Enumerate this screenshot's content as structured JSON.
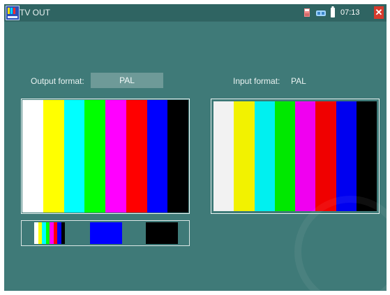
{
  "window": {
    "title": "TV OUT",
    "time": "07:13"
  },
  "icons": {
    "app": "app-icon",
    "save": "save-icon",
    "network": "network-icon",
    "battery": "battery-icon",
    "close": "close-icon"
  },
  "output": {
    "label": "Output format:",
    "value": "PAL"
  },
  "input": {
    "label": "Input format:",
    "value": "PAL"
  },
  "color_bars": [
    "#ffffff",
    "#ffff00",
    "#00ffff",
    "#00ff00",
    "#ff00ff",
    "#ff0000",
    "#0000ff",
    "#000000"
  ],
  "input_color_bars": [
    "#f2f2f2",
    "#f2f200",
    "#00f0f0",
    "#00e800",
    "#f000f0",
    "#f00000",
    "#0000f0",
    "#000000"
  ],
  "thumbnails": {
    "blue": "#0000ff",
    "black": "#000000"
  }
}
